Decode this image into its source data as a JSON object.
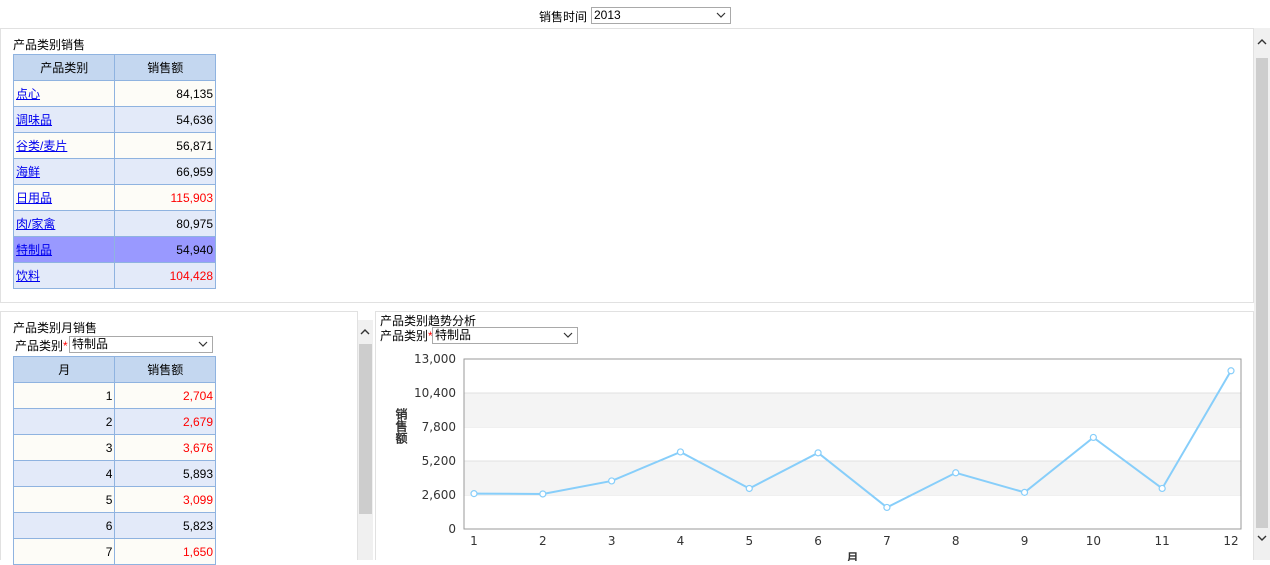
{
  "filter": {
    "label": "销售时间",
    "value": "2013"
  },
  "category_panel": {
    "title": "产品类别销售",
    "headers": [
      "产品类别",
      "销售额"
    ],
    "rows": [
      {
        "name": "点心",
        "value": "84,135",
        "red": false
      },
      {
        "name": "调味品",
        "value": "54,636",
        "red": false
      },
      {
        "name": "谷类/麦片",
        "value": "56,871",
        "red": false
      },
      {
        "name": "海鲜",
        "value": "66,959",
        "red": false
      },
      {
        "name": "日用品",
        "value": "115,903",
        "red": true
      },
      {
        "name": "肉/家禽",
        "value": "80,975",
        "red": false
      },
      {
        "name": "特制品",
        "value": "54,940",
        "red": false,
        "selected": true
      },
      {
        "name": "饮料",
        "value": "104,428",
        "red": true
      }
    ]
  },
  "monthly_panel": {
    "title": "产品类别月销售",
    "filter_label": "产品类别",
    "filter_value": "特制品",
    "headers": [
      "月",
      "销售额"
    ],
    "rows": [
      {
        "month": "1",
        "value": "2,704",
        "red": true
      },
      {
        "month": "2",
        "value": "2,679",
        "red": true
      },
      {
        "month": "3",
        "value": "3,676",
        "red": true
      },
      {
        "month": "4",
        "value": "5,893",
        "red": false
      },
      {
        "month": "5",
        "value": "3,099",
        "red": true
      },
      {
        "month": "6",
        "value": "5,823",
        "red": false
      },
      {
        "month": "7",
        "value": "1,650",
        "red": true
      }
    ]
  },
  "trend_panel": {
    "title": "产品类别趋势分析",
    "filter_label": "产品类别",
    "filter_value": "特制品"
  },
  "chart_data": {
    "type": "line",
    "title": "",
    "xlabel": "月",
    "ylabel": "销售额",
    "categories": [
      "1",
      "2",
      "3",
      "4",
      "5",
      "6",
      "7",
      "8",
      "9",
      "10",
      "11",
      "12"
    ],
    "values": [
      2704,
      2679,
      3676,
      5893,
      3099,
      5823,
      1650,
      4300,
      2800,
      7000,
      3100,
      12100
    ],
    "ylim": [
      0,
      13000
    ],
    "yticks": [
      "0",
      "2,600",
      "5,200",
      "7,800",
      "10,400",
      "13,000"
    ],
    "grid": "horizontal bands",
    "line_color": "#87cefa"
  }
}
